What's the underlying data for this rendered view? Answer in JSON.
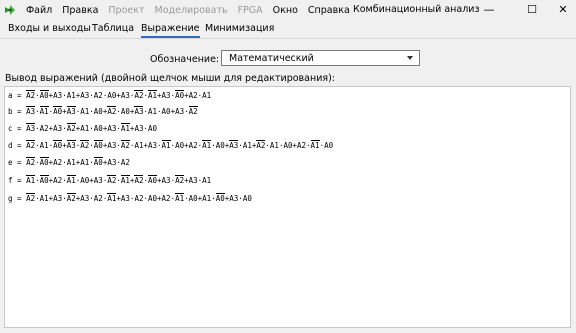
{
  "menu": [
    {
      "label": "Файл",
      "disabled": false
    },
    {
      "label": "Правка",
      "disabled": false
    },
    {
      "label": "Проект",
      "disabled": true
    },
    {
      "label": "Моделировать",
      "disabled": true
    },
    {
      "label": "FPGA",
      "disabled": true
    },
    {
      "label": "Окно",
      "disabled": false
    },
    {
      "label": "Справка",
      "disabled": false
    }
  ],
  "window_title": "Комбинационный анализ",
  "controls": {
    "minimize": "—",
    "maximize": "☐",
    "close": "✕"
  },
  "tabs": [
    "Входы и выходы",
    "Таблица",
    "Выражение",
    "Минимизация"
  ],
  "active_tab": "Выражение",
  "notation": {
    "label": "Обозначение:",
    "value": "Математический"
  },
  "output_label": "Вывод выражений (двойной щелчок мыши для редактирования):",
  "expressions": [
    {
      "name": "a",
      "terms": [
        [
          [
            "A2",
            1
          ],
          [
            "A0",
            1
          ]
        ],
        [
          [
            "A3",
            0
          ],
          [
            "A1",
            0
          ]
        ],
        [
          [
            "A3",
            0
          ],
          [
            "A2",
            0
          ],
          [
            "A0",
            0
          ]
        ],
        [
          [
            "A3",
            0
          ],
          [
            "A2",
            1
          ],
          [
            "A1",
            1
          ]
        ],
        [
          [
            "A3",
            0
          ],
          [
            "A0",
            1
          ]
        ],
        [
          [
            "A2",
            0
          ],
          [
            "A1",
            0
          ]
        ]
      ]
    },
    {
      "name": "b",
      "terms": [
        [
          [
            "A3",
            1
          ],
          [
            "A1",
            1
          ],
          [
            "A0",
            1
          ]
        ],
        [
          [
            "A3",
            1
          ],
          [
            "A1",
            0
          ],
          [
            "A0",
            0
          ]
        ],
        [
          [
            "A2",
            1
          ],
          [
            "A0",
            0
          ]
        ],
        [
          [
            "A3",
            1
          ],
          [
            "A1",
            0
          ],
          [
            "A0",
            0
          ]
        ],
        [
          [
            "A3",
            0
          ],
          [
            "A2",
            1
          ]
        ]
      ]
    },
    {
      "name": "c",
      "terms": [
        [
          [
            "A3",
            1
          ],
          [
            "A2",
            0
          ]
        ],
        [
          [
            "A3",
            0
          ],
          [
            "A2",
            1
          ]
        ],
        [
          [
            "A1",
            0
          ],
          [
            "A0",
            0
          ]
        ],
        [
          [
            "A3",
            0
          ],
          [
            "A1",
            1
          ]
        ],
        [
          [
            "A3",
            0
          ],
          [
            "A0",
            0
          ]
        ]
      ]
    },
    {
      "name": "d",
      "terms": [
        [
          [
            "A2",
            1
          ],
          [
            "A1",
            0
          ],
          [
            "A0",
            1
          ]
        ],
        [
          [
            "A3",
            1
          ],
          [
            "A2",
            1
          ],
          [
            "A0",
            1
          ]
        ],
        [
          [
            "A3",
            0
          ],
          [
            "A2",
            1
          ],
          [
            "A1",
            0
          ]
        ],
        [
          [
            "A3",
            0
          ],
          [
            "A1",
            1
          ],
          [
            "A0",
            0
          ]
        ],
        [
          [
            "A2",
            0
          ],
          [
            "A1",
            1
          ],
          [
            "A0",
            0
          ]
        ],
        [
          [
            "A3",
            1
          ],
          [
            "A1",
            0
          ]
        ],
        [
          [
            "A2",
            1
          ],
          [
            "A1",
            0
          ],
          [
            "A0",
            0
          ]
        ],
        [
          [
            "A2",
            0
          ],
          [
            "A1",
            1
          ],
          [
            "A0",
            0
          ]
        ]
      ]
    },
    {
      "name": "e",
      "terms": [
        [
          [
            "A2",
            1
          ],
          [
            "A0",
            1
          ]
        ],
        [
          [
            "A2",
            0
          ],
          [
            "A1",
            0
          ]
        ],
        [
          [
            "A1",
            0
          ],
          [
            "A0",
            1
          ]
        ],
        [
          [
            "A3",
            0
          ],
          [
            "A2",
            0
          ]
        ]
      ]
    },
    {
      "name": "f",
      "terms": [
        [
          [
            "A1",
            1
          ],
          [
            "A0",
            1
          ]
        ],
        [
          [
            "A2",
            0
          ],
          [
            "A1",
            1
          ],
          [
            "A0",
            0
          ]
        ],
        [
          [
            "A3",
            0
          ],
          [
            "A2",
            1
          ],
          [
            "A1",
            1
          ]
        ],
        [
          [
            "A2",
            1
          ],
          [
            "A0",
            1
          ]
        ],
        [
          [
            "A3",
            0
          ],
          [
            "A2",
            1
          ]
        ],
        [
          [
            "A3",
            0
          ],
          [
            "A1",
            0
          ]
        ]
      ]
    },
    {
      "name": "g",
      "terms": [
        [
          [
            "A2",
            1
          ],
          [
            "A1",
            0
          ]
        ],
        [
          [
            "A3",
            0
          ],
          [
            "A2",
            1
          ]
        ],
        [
          [
            "A3",
            0
          ],
          [
            "A2",
            0
          ],
          [
            "A1",
            1
          ]
        ],
        [
          [
            "A3",
            0
          ],
          [
            "A2",
            0
          ],
          [
            "A0",
            0
          ]
        ],
        [
          [
            "A2",
            0
          ],
          [
            "A1",
            1
          ],
          [
            "A0",
            0
          ]
        ],
        [
          [
            "A1",
            0
          ],
          [
            "A0",
            1
          ]
        ],
        [
          [
            "A3",
            0
          ],
          [
            "A0",
            0
          ]
        ]
      ]
    }
  ]
}
